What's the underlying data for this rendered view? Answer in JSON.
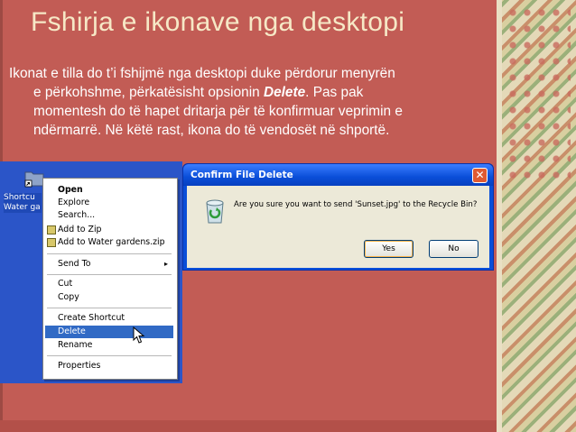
{
  "slide": {
    "title": "Fshirja e ikonave nga desktopi",
    "body_line1": "Ikonat e tilla do t’i fshijmë nga desktopi duke përdorur menyrën",
    "body_line2_pre": "e përkohshme, përkatësisht opsionin ",
    "body_line2_em": "Delete",
    "body_line2_post": ". Pas pak",
    "body_line3": "momentesh do të hapet dritarja për të konfirmuar veprimin e",
    "body_line4": "ndërmarrë. Në këtë rast, ikona do të vendosët në shportë."
  },
  "desktop": {
    "icon_label_1": "Shortcu",
    "icon_label_2": "Water ga"
  },
  "context_menu": {
    "open": "Open",
    "explore": "Explore",
    "search": "Search...",
    "add_zip": "Add to Zip",
    "add_water_zip": "Add to Water gardens.zip",
    "send_to": "Send To",
    "cut": "Cut",
    "copy": "Copy",
    "create_shortcut": "Create Shortcut",
    "delete": "Delete",
    "rename": "Rename",
    "properties": "Properties",
    "submenu_arrow": "▸"
  },
  "dialog": {
    "title": "Confirm File Delete",
    "close": "✕",
    "message": "Are you sure you want to send 'Sunset.jpg' to the Recycle Bin?",
    "yes": "Yes",
    "no": "No"
  }
}
